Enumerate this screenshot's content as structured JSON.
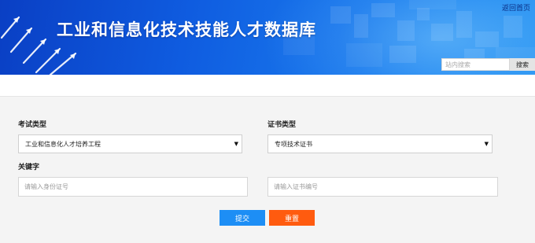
{
  "header": {
    "home_link": "返回首页",
    "title": "工业和信息化技术技能人才数据库",
    "search": {
      "placeholder": "站内搜索",
      "value": "",
      "button_label": "搜索"
    }
  },
  "form": {
    "exam_type": {
      "label": "考试类型",
      "selected": "工业和信息化人才培养工程"
    },
    "cert_type": {
      "label": "证书类型",
      "selected": "专项技术证书"
    },
    "keyword": {
      "label": "关键字",
      "id_placeholder": "请输入身份证号",
      "cert_placeholder": "请输入证书编号"
    },
    "submit_label": "提交",
    "reset_label": "重置"
  },
  "colors": {
    "banner": "#0f5ce0",
    "submit": "#1d8ef5",
    "reset": "#ff5b0f",
    "panel": "#f4f4f4"
  }
}
